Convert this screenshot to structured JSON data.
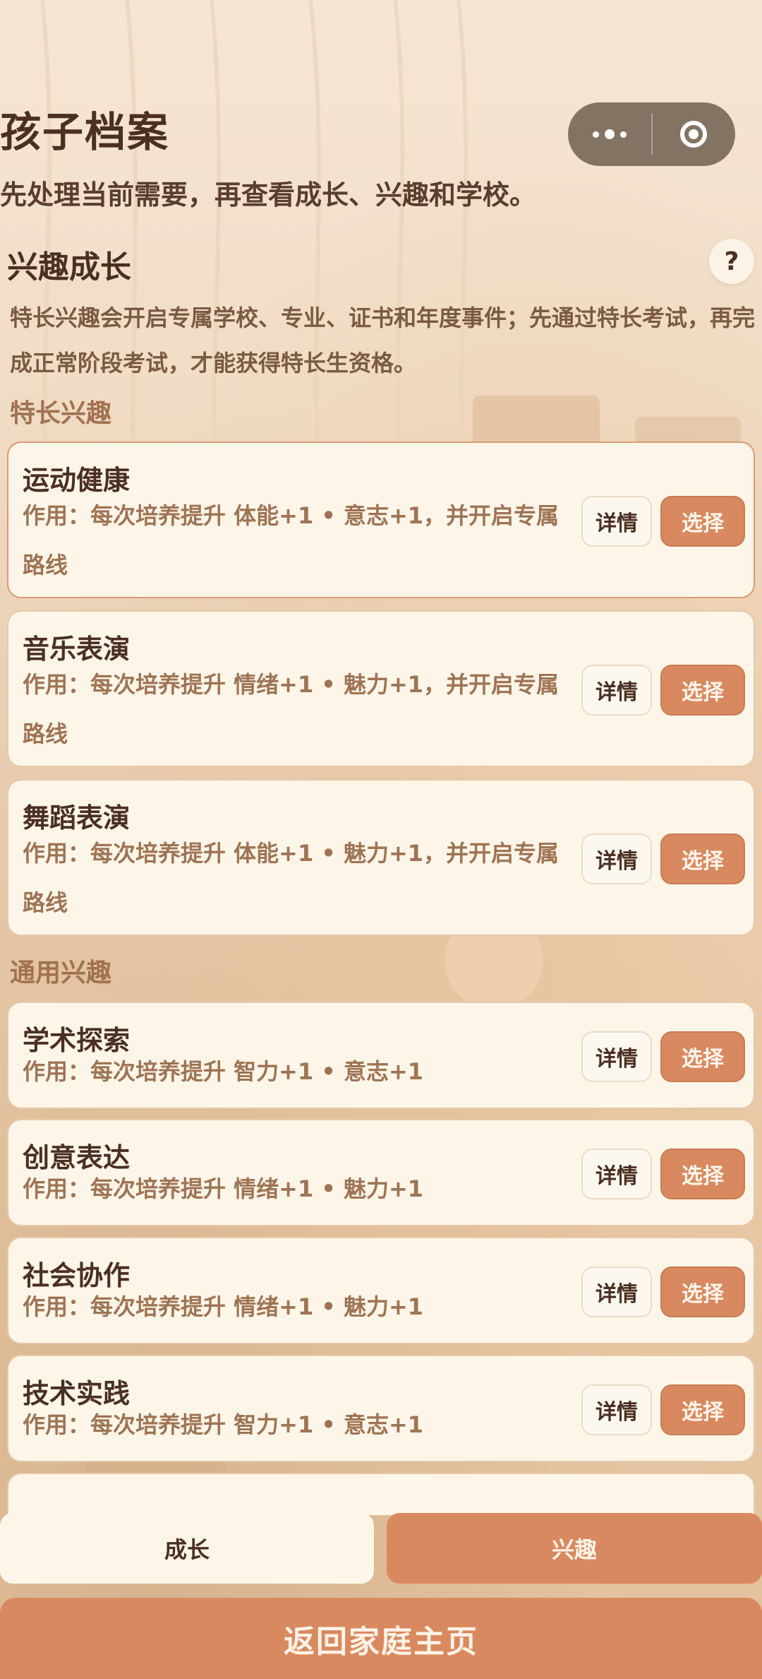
{
  "page": {
    "title": "孩子档案",
    "subtitle": "先处理当前需要，再查看成长、兴趣和学校。"
  },
  "section": {
    "title": "兴趣成长",
    "help_label": "?",
    "intro": "特长兴趣会开启专属学校、专业、证书和年度事件；先通过特长考试，再完成正常阶段考试，才能获得特长生资格。"
  },
  "special": {
    "label": "特长兴趣",
    "items": [
      {
        "name": "运动健康",
        "effect": "作用：每次培养提升 体能+1 • 意志+1，并开启专属路线",
        "detail": "详情",
        "select": "选择"
      },
      {
        "name": "音乐表演",
        "effect": "作用：每次培养提升 情绪+1 • 魅力+1，并开启专属路线",
        "detail": "详情",
        "select": "选择"
      },
      {
        "name": "舞蹈表演",
        "effect": "作用：每次培养提升 体能+1 • 魅力+1，并开启专属路线",
        "detail": "详情",
        "select": "选择"
      }
    ]
  },
  "general": {
    "label": "通用兴趣",
    "items": [
      {
        "name": "学术探索",
        "effect": "作用：每次培养提升 智力+1 • 意志+1",
        "detail": "详情",
        "select": "选择"
      },
      {
        "name": "创意表达",
        "effect": "作用：每次培养提升 情绪+1 • 魅力+1",
        "detail": "详情",
        "select": "选择"
      },
      {
        "name": "社会协作",
        "effect": "作用：每次培养提升 情绪+1 • 魅力+1",
        "detail": "详情",
        "select": "选择"
      },
      {
        "name": "技术实践",
        "effect": "作用：每次培养提升 智力+1 • 意志+1",
        "detail": "详情",
        "select": "选择"
      }
    ]
  },
  "tabs": {
    "growth": "成长",
    "interest": "兴趣",
    "active": "interest"
  },
  "footer": {
    "home_label": "返回家庭主页"
  },
  "colors": {
    "accent": "#d9895f",
    "card_bg": "#fdf6e8",
    "text_dark": "#4a2f22",
    "text_muted": "#9e7455"
  },
  "icons": {
    "capsule_more": "more-dots-icon",
    "capsule_close": "target-icon",
    "help": "help-icon"
  }
}
